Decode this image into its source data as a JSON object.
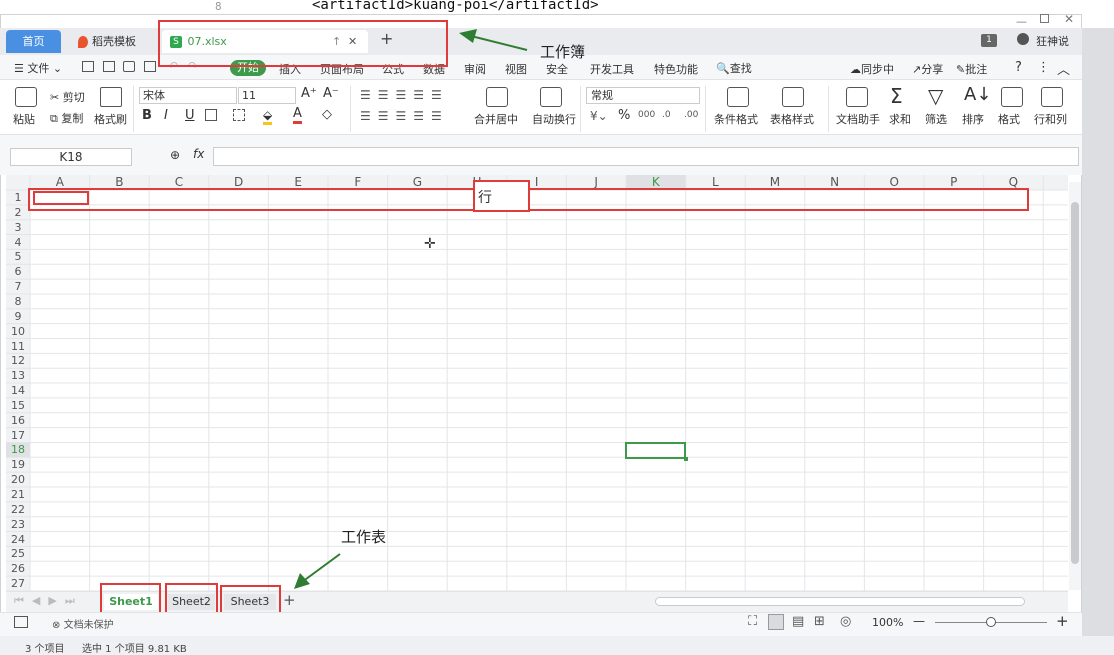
{
  "background": {
    "code_text": "<artifactId>kuang-poi</artifactId>",
    "line_no": "8"
  },
  "tabs": {
    "home": "首页",
    "template": "稻壳模板",
    "file": "07.xlsx",
    "new_tab": "+",
    "badge": "1",
    "user": "狂神说"
  },
  "menu": {
    "file": "文件",
    "items": [
      "开始",
      "插入",
      "页面布局",
      "公式",
      "数据",
      "审阅",
      "视图",
      "安全",
      "开发工具",
      "特色功能"
    ],
    "search": "查找",
    "sync": "同步中",
    "share": "分享",
    "comment": "批注",
    "help": "?"
  },
  "ribbon": {
    "paste": "粘贴",
    "cut": "剪切",
    "copy": "复制",
    "format_painter": "格式刷",
    "font": "宋体",
    "font_size": "11",
    "bold": "B",
    "italic": "I",
    "underline": "U",
    "merge": "合并居中",
    "wrap": "自动换行",
    "number_format": "常规",
    "percent": "%",
    "cond_format": "条件格式",
    "table_style": "表格样式",
    "doc_helper": "文档助手",
    "sum": "求和",
    "filter": "筛选",
    "sort": "排序",
    "format": "格式",
    "rowcol": "行和列"
  },
  "formula_bar": {
    "cell_ref": "K18",
    "fx": "fx",
    "value": ""
  },
  "grid": {
    "columns": [
      "A",
      "B",
      "C",
      "D",
      "E",
      "F",
      "G",
      "H",
      "I",
      "J",
      "K",
      "L",
      "M",
      "N",
      "O",
      "P",
      "Q"
    ],
    "rows": [
      "1",
      "2",
      "3",
      "4",
      "5",
      "6",
      "7",
      "8",
      "9",
      "10",
      "11",
      "12",
      "13",
      "14",
      "15",
      "16",
      "17",
      "18",
      "19",
      "20",
      "21",
      "22",
      "23",
      "24",
      "25",
      "26",
      "27"
    ],
    "selected_cell": "K18"
  },
  "annotations": {
    "workbook": "工作簿",
    "worksheet": "工作表",
    "row": "行"
  },
  "sheets": [
    "Sheet1",
    "Sheet2",
    "Sheet3"
  ],
  "add_sheet": "+",
  "status": {
    "protect": "文档未保护",
    "zoom": "100%",
    "minus": "—",
    "plus": "+"
  },
  "explorer": {
    "count": "3 个项目",
    "selected": "选中 1 个项目 9.81 KB"
  },
  "colors": {
    "accent": "#3c9a4a",
    "annotation_red": "#e03b3b",
    "tab_blue": "#4a90e2",
    "arrow_green": "#2e7d32"
  }
}
